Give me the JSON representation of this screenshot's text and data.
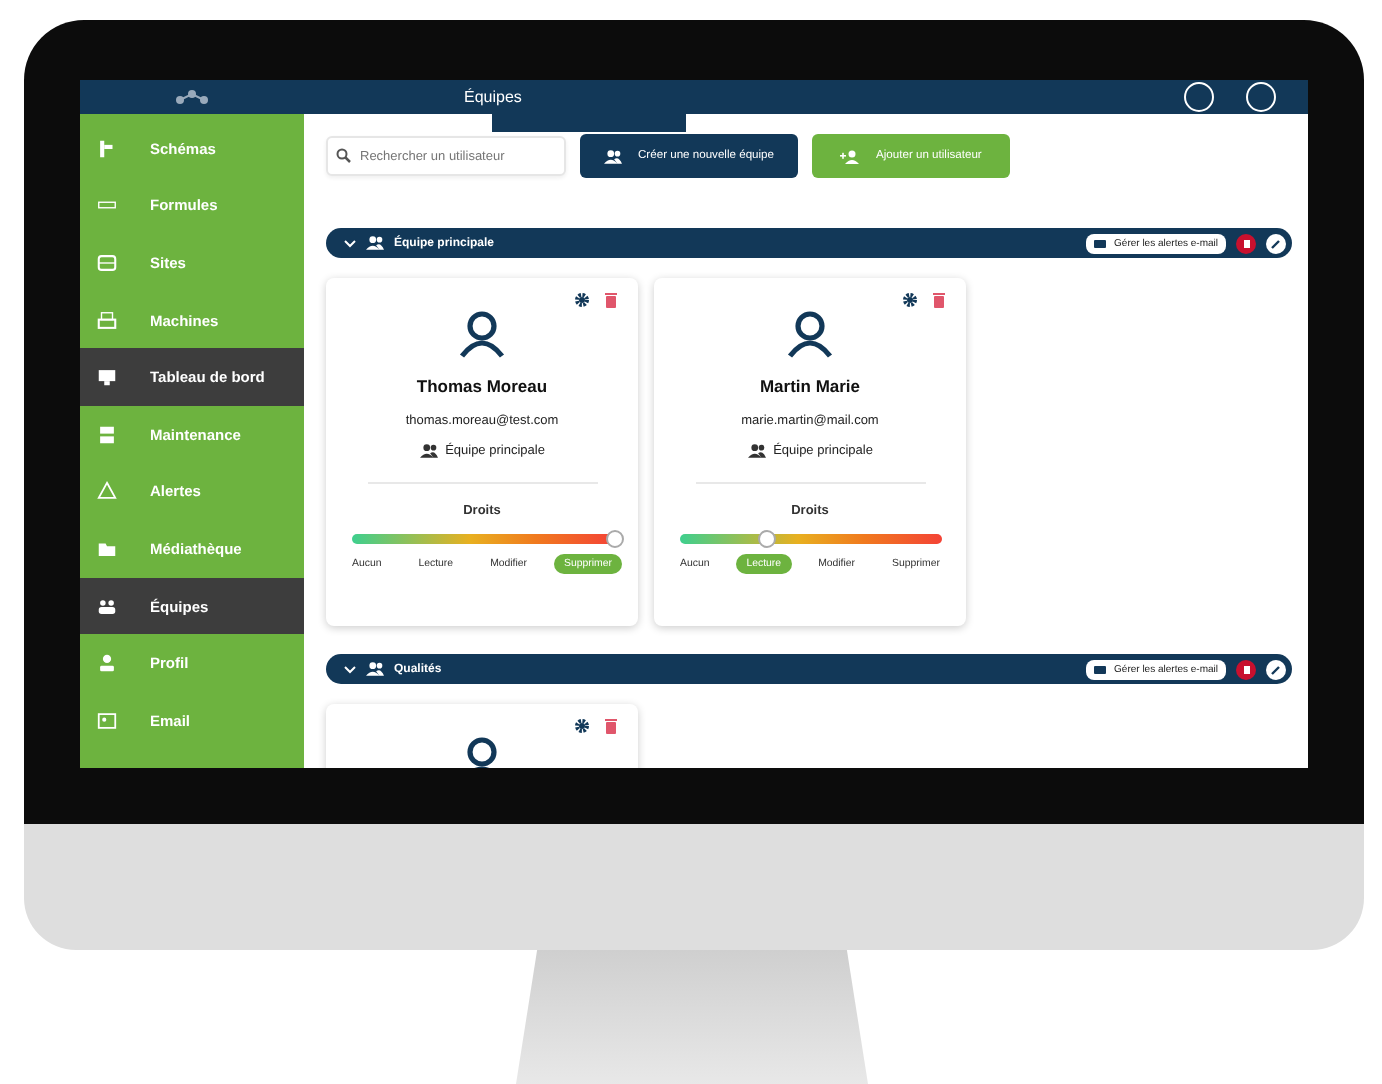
{
  "header": {
    "title": "Équipes"
  },
  "sidebar": {
    "items": [
      {
        "label": "Schémas",
        "selected": false
      },
      {
        "label": "Formules",
        "selected": false
      },
      {
        "label": "Sites",
        "selected": false
      },
      {
        "label": "Machines",
        "selected": false
      },
      {
        "label": "Tableau de bord",
        "selected": true
      },
      {
        "label": "Maintenance",
        "selected": false
      },
      {
        "label": "Alertes",
        "selected": false
      },
      {
        "label": "Médiathèque",
        "selected": false
      },
      {
        "label": "Équipes",
        "selected": true
      },
      {
        "label": "Profil",
        "selected": false
      },
      {
        "label": "Email",
        "selected": false
      }
    ]
  },
  "toolbar": {
    "search": {
      "placeholder": "Rechercher un utilisateur"
    },
    "buttons": [
      {
        "label": "Créer une nouvelle équipe",
        "kind": "primary"
      },
      {
        "label": "Ajouter un utilisateur",
        "kind": "success"
      }
    ]
  },
  "teams": [
    {
      "name": "Équipe principale",
      "expanded": true,
      "alerts_button": "Gérer les alertes e-mail",
      "members": [
        {
          "kind": "full",
          "name": "Thomas Moreau",
          "email": "thomas.moreau@test.com",
          "team": "Équipe principale",
          "rights_title": "Droits",
          "level": 1,
          "rights": [
            {
              "label": "Aucun",
              "selected": false
            },
            {
              "label": "Lecture",
              "selected": false
            },
            {
              "label": "Modifier",
              "selected": false
            },
            {
              "label": "Supprimer",
              "selected": true
            }
          ]
        },
        {
          "kind": "full",
          "name": "Martin Marie",
          "email": "marie.martin@mail.com",
          "team": "Équipe principale",
          "rights_title": "Droits",
          "level": 0.33,
          "rights": [
            {
              "label": "Aucun",
              "selected": false
            },
            {
              "label": "Lecture",
              "selected": true
            },
            {
              "label": "Modifier",
              "selected": false
            },
            {
              "label": "Supprimer",
              "selected": false
            }
          ]
        }
      ]
    },
    {
      "name": "Qualités",
      "expanded": true,
      "alerts_button": "Gérer les alertes e-mail",
      "members": [
        {
          "kind": "clipped"
        }
      ]
    }
  ]
}
